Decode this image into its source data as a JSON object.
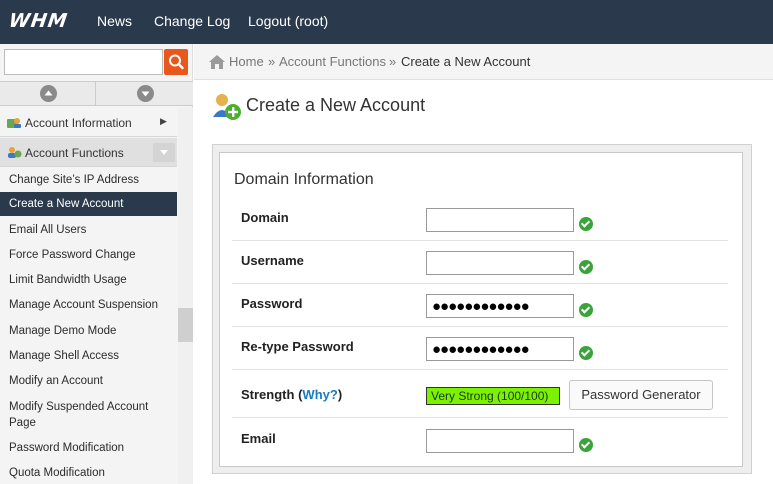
{
  "topbar": {
    "logo": "WHM",
    "nav": [
      "News",
      "Change Log",
      "Logout (root)"
    ]
  },
  "sidebar": {
    "search_value": "",
    "categories": [
      {
        "label": "Account Information",
        "state": "collapsed"
      },
      {
        "label": "Account Functions",
        "state": "expanded"
      }
    ],
    "items": [
      "Change Site’s IP Address",
      "Create a New Account",
      "Email All Users",
      "Force Password Change",
      "Limit Bandwidth Usage",
      "Manage Account Suspension",
      "Manage Demo Mode",
      "Manage Shell Access",
      "Modify an Account",
      "Modify Suspended Account Page",
      "Password Modification",
      "Quota Modification"
    ],
    "active_item": "Create a New Account"
  },
  "breadcrumb": {
    "items": [
      "Home",
      "Account Functions",
      "Create a New Account"
    ],
    "separator": "»"
  },
  "page": {
    "title": "Create a New Account",
    "section_title": "Domain Information",
    "fields": [
      {
        "label": "Domain",
        "value": ""
      },
      {
        "label": "Username",
        "value": ""
      },
      {
        "label": "Password",
        "value": "●●●●●●●●●●●●"
      },
      {
        "label": "Re-type Password",
        "value": "●●●●●●●●●●●●"
      },
      {
        "label": "Email",
        "value": ""
      }
    ],
    "strength": {
      "label": "Strength",
      "open_paren": "(",
      "why_link": "Why?",
      "close_paren": ")",
      "value": "Very Strong (100/100)",
      "generator_button": "Password Generator"
    }
  },
  "colors": {
    "topbar_bg": "#2a3a4c",
    "accent_orange": "#e8571b",
    "strength_green": "#7cf200",
    "check_green": "#3aa339",
    "link_blue": "#1a7bc4"
  },
  "icons": [
    "search-icon",
    "arrow-up-icon",
    "arrow-down-icon",
    "account-info-icon",
    "account-functions-icon",
    "home-icon",
    "create-account-icon",
    "check-icon"
  ]
}
